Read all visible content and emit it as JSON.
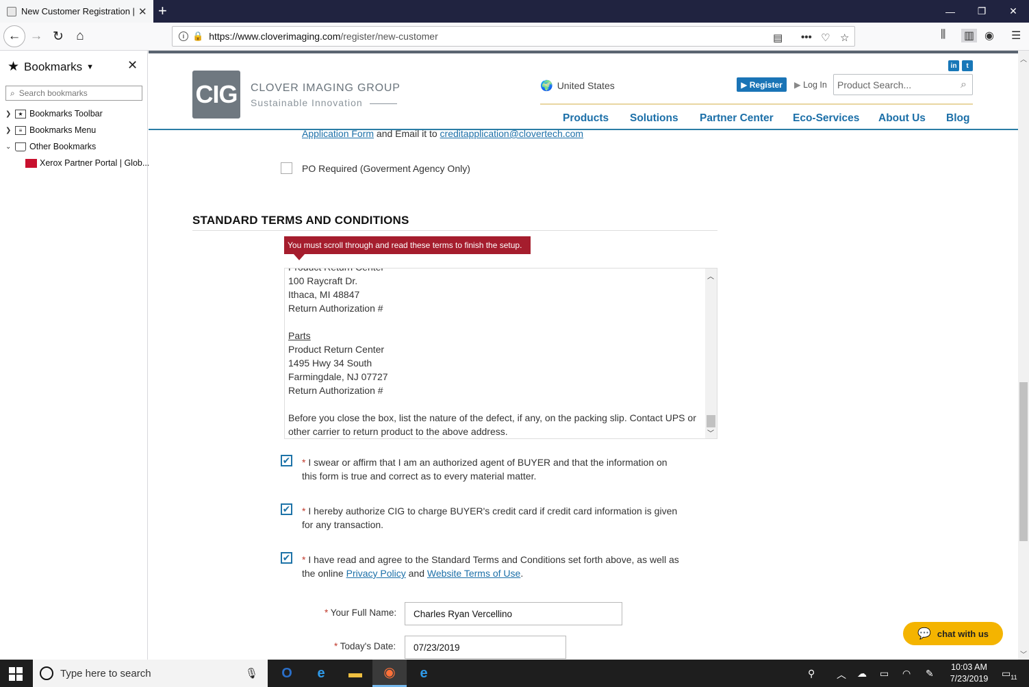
{
  "browser": {
    "tab_title": "New Customer Registration | Cl",
    "url_domain": "https://www.cloverimaging.com",
    "url_path": "/register/new-customer"
  },
  "sidebar": {
    "title": "Bookmarks",
    "search_placeholder": "Search bookmarks",
    "items": [
      {
        "label": "Bookmarks Toolbar"
      },
      {
        "label": "Bookmarks Menu"
      },
      {
        "label": "Other Bookmarks"
      },
      {
        "label": "Xerox Partner Portal | Glob..."
      }
    ]
  },
  "site": {
    "logo_letters": "CIG",
    "brand_name": "CLOVER IMAGING GROUP",
    "tagline": "Sustainable Innovation",
    "country": "United States",
    "register_label": "Register",
    "login_label": "Log In",
    "search_placeholder": "Product Search...",
    "menu": [
      "Products",
      "Solutions",
      "Partner Center",
      "Eco-Services",
      "About Us",
      "Blog"
    ],
    "accent_color": "#1b6fa8"
  },
  "form": {
    "app_form_link": "Application Form",
    "app_form_mid": " and Email it to ",
    "credit_email": "creditapplication@clovertech.com",
    "po_label": "PO Required (Goverment Agency Only)",
    "section_title": "STANDARD TERMS AND CONDITIONS",
    "tooltip": "You must scroll through and read these terms to finish the setup.",
    "terms_lines": [
      "Product Return Center",
      "100 Raycraft Dr.",
      "Ithaca, MI 48847",
      "Return Authorization #",
      "",
      "Parts",
      "Product Return Center",
      "1495 Hwy 34 South",
      "Farmingdale, NJ 07727",
      "Return Authorization #",
      "",
      "Before you close the box, list the nature of the defect, if any, on the packing slip. Contact UPS or",
      "other carrier to return product to the above address."
    ],
    "agree1_line1": "I swear or affirm that I am an authorized agent of BUYER and that the information on",
    "agree1_line2": "this form is true and correct as to every material matter.",
    "agree2_line1": "I hereby authorize CIG to charge BUYER's credit card if credit card information is given",
    "agree2_line2": "for any transaction.",
    "agree3_line1": "I have read and agree to the Standard Terms and Conditions set forth above, as well as",
    "agree3_line2_pre": "the online ",
    "privacy_link": "Privacy Policy",
    "and": " and ",
    "terms_link": "Website Terms of Use",
    "period": ".",
    "name_label": "Your Full Name:",
    "name_value": "Charles Ryan Vercellino",
    "date_label": "Today's Date:",
    "date_value": "07/23/2019",
    "required_mark": "*"
  },
  "chat": {
    "label": "chat with us"
  },
  "taskbar": {
    "search_placeholder": "Type here to search",
    "time": "10:03 AM",
    "date": "7/23/2019",
    "notif_count": "11"
  }
}
